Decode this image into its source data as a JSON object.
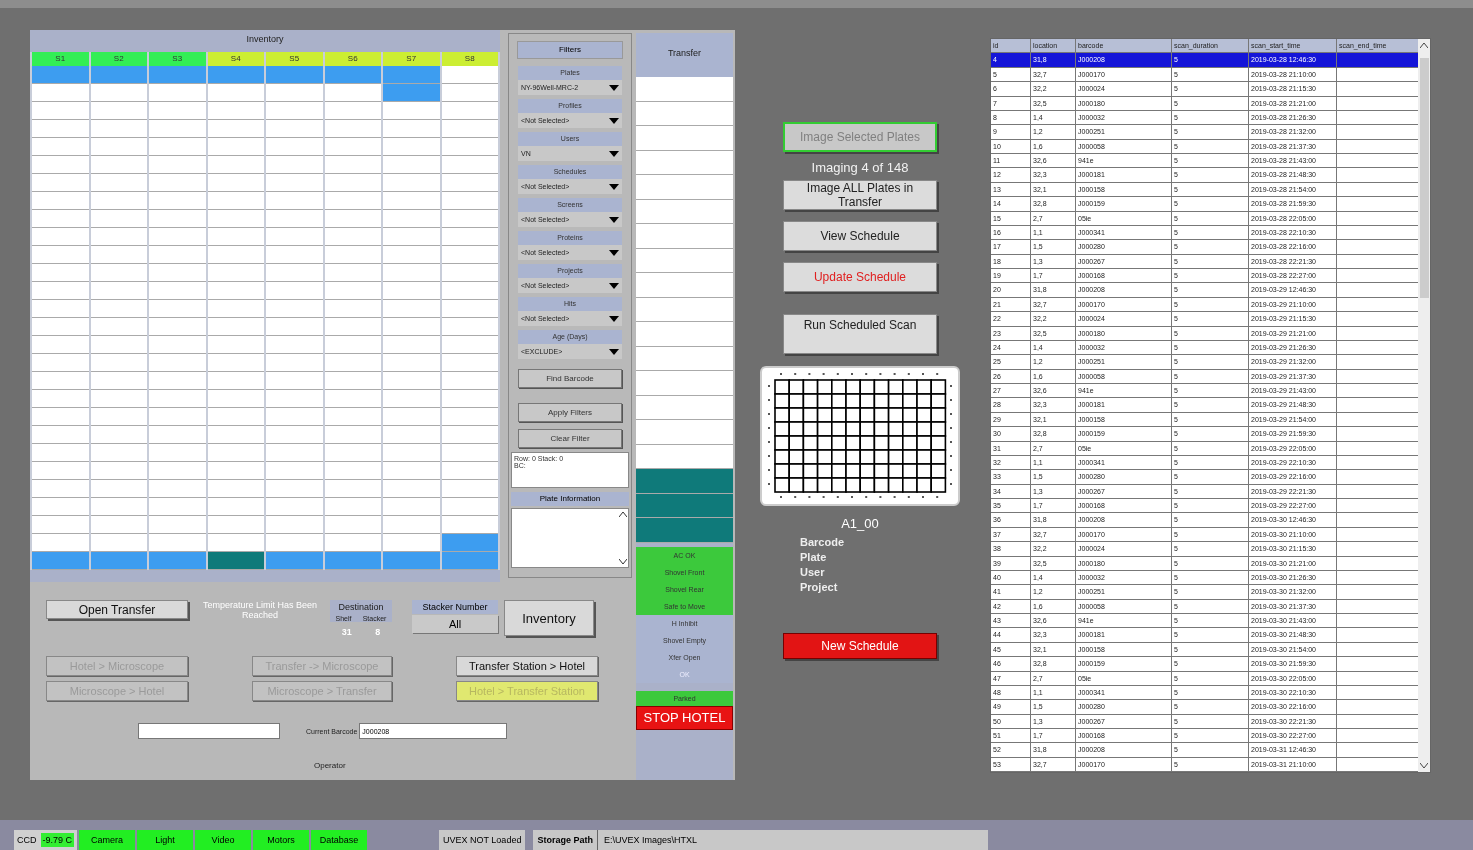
{
  "inventory": {
    "title": "Inventory",
    "columns": [
      {
        "label": "S1",
        "color": "#33ee55",
        "slots": [
          {
            "color": "#3d9df0"
          },
          {
            "color": "#ffffff"
          },
          {
            "color": "#ffffff"
          },
          {
            "color": "#ffffff"
          },
          {
            "color": "#ffffff"
          },
          {
            "color": "#ffffff"
          },
          {
            "color": "#ffffff"
          },
          {
            "color": "#ffffff"
          },
          {
            "color": "#ffffff"
          },
          {
            "color": "#ffffff"
          },
          {
            "color": "#ffffff"
          },
          {
            "color": "#ffffff"
          },
          {
            "color": "#ffffff"
          },
          {
            "color": "#ffffff"
          },
          {
            "color": "#ffffff"
          },
          {
            "color": "#ffffff"
          },
          {
            "color": "#ffffff"
          },
          {
            "color": "#ffffff"
          },
          {
            "color": "#ffffff"
          },
          {
            "color": "#ffffff"
          },
          {
            "color": "#ffffff"
          },
          {
            "color": "#ffffff"
          },
          {
            "color": "#ffffff"
          },
          {
            "color": "#ffffff"
          },
          {
            "color": "#ffffff"
          },
          {
            "color": "#ffffff"
          },
          {
            "color": "#ffffff"
          },
          {
            "color": "#3d9df0"
          }
        ]
      },
      {
        "label": "S2",
        "color": "#33ee55",
        "slots": [
          {
            "color": "#3d9df0"
          },
          {
            "color": "#ffffff"
          },
          {
            "color": "#ffffff"
          },
          {
            "color": "#ffffff"
          },
          {
            "color": "#ffffff"
          },
          {
            "color": "#ffffff"
          },
          {
            "color": "#ffffff"
          },
          {
            "color": "#ffffff"
          },
          {
            "color": "#ffffff"
          },
          {
            "color": "#ffffff"
          },
          {
            "color": "#ffffff"
          },
          {
            "color": "#ffffff"
          },
          {
            "color": "#ffffff"
          },
          {
            "color": "#ffffff"
          },
          {
            "color": "#ffffff"
          },
          {
            "color": "#ffffff"
          },
          {
            "color": "#ffffff"
          },
          {
            "color": "#ffffff"
          },
          {
            "color": "#ffffff"
          },
          {
            "color": "#ffffff"
          },
          {
            "color": "#ffffff"
          },
          {
            "color": "#ffffff"
          },
          {
            "color": "#ffffff"
          },
          {
            "color": "#ffffff"
          },
          {
            "color": "#ffffff"
          },
          {
            "color": "#ffffff"
          },
          {
            "color": "#ffffff"
          },
          {
            "color": "#3d9df0"
          }
        ]
      },
      {
        "label": "S3",
        "color": "#33ee55",
        "slots": [
          {
            "color": "#3d9df0"
          },
          {
            "color": "#ffffff"
          },
          {
            "color": "#ffffff"
          },
          {
            "color": "#ffffff"
          },
          {
            "color": "#ffffff"
          },
          {
            "color": "#ffffff"
          },
          {
            "color": "#ffffff"
          },
          {
            "color": "#ffffff"
          },
          {
            "color": "#ffffff"
          },
          {
            "color": "#ffffff"
          },
          {
            "color": "#ffffff"
          },
          {
            "color": "#ffffff"
          },
          {
            "color": "#ffffff"
          },
          {
            "color": "#ffffff"
          },
          {
            "color": "#ffffff"
          },
          {
            "color": "#ffffff"
          },
          {
            "color": "#ffffff"
          },
          {
            "color": "#ffffff"
          },
          {
            "color": "#ffffff"
          },
          {
            "color": "#ffffff"
          },
          {
            "color": "#ffffff"
          },
          {
            "color": "#ffffff"
          },
          {
            "color": "#ffffff"
          },
          {
            "color": "#ffffff"
          },
          {
            "color": "#ffffff"
          },
          {
            "color": "#ffffff"
          },
          {
            "color": "#ffffff"
          },
          {
            "color": "#3d9df0"
          }
        ]
      },
      {
        "label": "S4",
        "color": "#ccee33",
        "slots": [
          {
            "color": "#3d9df0"
          },
          {
            "color": "#ffffff"
          },
          {
            "color": "#ffffff"
          },
          {
            "color": "#ffffff"
          },
          {
            "color": "#ffffff"
          },
          {
            "color": "#ffffff"
          },
          {
            "color": "#ffffff"
          },
          {
            "color": "#ffffff"
          },
          {
            "color": "#ffffff"
          },
          {
            "color": "#ffffff"
          },
          {
            "color": "#ffffff"
          },
          {
            "color": "#ffffff"
          },
          {
            "color": "#ffffff"
          },
          {
            "color": "#ffffff"
          },
          {
            "color": "#ffffff"
          },
          {
            "color": "#ffffff"
          },
          {
            "color": "#ffffff"
          },
          {
            "color": "#ffffff"
          },
          {
            "color": "#ffffff"
          },
          {
            "color": "#ffffff"
          },
          {
            "color": "#ffffff"
          },
          {
            "color": "#ffffff"
          },
          {
            "color": "#ffffff"
          },
          {
            "color": "#ffffff"
          },
          {
            "color": "#ffffff"
          },
          {
            "color": "#ffffff"
          },
          {
            "color": "#ffffff"
          },
          {
            "color": "#0f7a7a"
          }
        ]
      },
      {
        "label": "S5",
        "color": "#ccee33",
        "slots": [
          {
            "color": "#3d9df0"
          },
          {
            "color": "#ffffff"
          },
          {
            "color": "#ffffff"
          },
          {
            "color": "#ffffff"
          },
          {
            "color": "#ffffff"
          },
          {
            "color": "#ffffff"
          },
          {
            "color": "#ffffff"
          },
          {
            "color": "#ffffff"
          },
          {
            "color": "#ffffff"
          },
          {
            "color": "#ffffff"
          },
          {
            "color": "#ffffff"
          },
          {
            "color": "#ffffff"
          },
          {
            "color": "#ffffff"
          },
          {
            "color": "#ffffff"
          },
          {
            "color": "#ffffff"
          },
          {
            "color": "#ffffff"
          },
          {
            "color": "#ffffff"
          },
          {
            "color": "#ffffff"
          },
          {
            "color": "#ffffff"
          },
          {
            "color": "#ffffff"
          },
          {
            "color": "#ffffff"
          },
          {
            "color": "#ffffff"
          },
          {
            "color": "#ffffff"
          },
          {
            "color": "#ffffff"
          },
          {
            "color": "#ffffff"
          },
          {
            "color": "#ffffff"
          },
          {
            "color": "#ffffff"
          },
          {
            "color": "#3d9df0"
          }
        ]
      },
      {
        "label": "S6",
        "color": "#ccee33",
        "slots": [
          {
            "color": "#3d9df0"
          },
          {
            "color": "#ffffff"
          },
          {
            "color": "#ffffff"
          },
          {
            "color": "#ffffff"
          },
          {
            "color": "#ffffff"
          },
          {
            "color": "#ffffff"
          },
          {
            "color": "#ffffff"
          },
          {
            "color": "#ffffff"
          },
          {
            "color": "#ffffff"
          },
          {
            "color": "#ffffff"
          },
          {
            "color": "#ffffff"
          },
          {
            "color": "#ffffff"
          },
          {
            "color": "#ffffff"
          },
          {
            "color": "#ffffff"
          },
          {
            "color": "#ffffff"
          },
          {
            "color": "#ffffff"
          },
          {
            "color": "#ffffff"
          },
          {
            "color": "#ffffff"
          },
          {
            "color": "#ffffff"
          },
          {
            "color": "#ffffff"
          },
          {
            "color": "#ffffff"
          },
          {
            "color": "#ffffff"
          },
          {
            "color": "#ffffff"
          },
          {
            "color": "#ffffff"
          },
          {
            "color": "#ffffff"
          },
          {
            "color": "#ffffff"
          },
          {
            "color": "#ffffff"
          },
          {
            "color": "#3d9df0"
          }
        ]
      },
      {
        "label": "S7",
        "color": "#ccee33",
        "slots": [
          {
            "color": "#3d9df0"
          },
          {
            "color": "#3d9df0"
          },
          {
            "color": "#ffffff"
          },
          {
            "color": "#ffffff"
          },
          {
            "color": "#ffffff"
          },
          {
            "color": "#ffffff"
          },
          {
            "color": "#ffffff"
          },
          {
            "color": "#ffffff"
          },
          {
            "color": "#ffffff"
          },
          {
            "color": "#ffffff"
          },
          {
            "color": "#ffffff"
          },
          {
            "color": "#ffffff"
          },
          {
            "color": "#ffffff"
          },
          {
            "color": "#ffffff"
          },
          {
            "color": "#ffffff"
          },
          {
            "color": "#ffffff"
          },
          {
            "color": "#ffffff"
          },
          {
            "color": "#ffffff"
          },
          {
            "color": "#ffffff"
          },
          {
            "color": "#ffffff"
          },
          {
            "color": "#ffffff"
          },
          {
            "color": "#ffffff"
          },
          {
            "color": "#ffffff"
          },
          {
            "color": "#ffffff"
          },
          {
            "color": "#ffffff"
          },
          {
            "color": "#ffffff"
          },
          {
            "color": "#ffffff"
          },
          {
            "color": "#3d9df0"
          }
        ]
      },
      {
        "label": "S8",
        "color": "#ccee33",
        "slots": [
          {
            "color": "#ffffff"
          },
          {
            "color": "#ffffff"
          },
          {
            "color": "#ffffff"
          },
          {
            "color": "#ffffff"
          },
          {
            "color": "#ffffff"
          },
          {
            "color": "#ffffff"
          },
          {
            "color": "#ffffff"
          },
          {
            "color": "#ffffff"
          },
          {
            "color": "#ffffff"
          },
          {
            "color": "#ffffff"
          },
          {
            "color": "#ffffff"
          },
          {
            "color": "#ffffff"
          },
          {
            "color": "#ffffff"
          },
          {
            "color": "#ffffff"
          },
          {
            "color": "#ffffff"
          },
          {
            "color": "#ffffff"
          },
          {
            "color": "#ffffff"
          },
          {
            "color": "#ffffff"
          },
          {
            "color": "#ffffff"
          },
          {
            "color": "#ffffff"
          },
          {
            "color": "#ffffff"
          },
          {
            "color": "#ffffff"
          },
          {
            "color": "#ffffff"
          },
          {
            "color": "#ffffff"
          },
          {
            "color": "#ffffff"
          },
          {
            "color": "#ffffff"
          },
          {
            "color": "#3d9df0"
          },
          {
            "color": "#3d9df0"
          }
        ]
      }
    ]
  },
  "filters": {
    "title": "Filters",
    "groups": [
      {
        "label": "Plates",
        "value": "NY-96Well-MRC-2"
      },
      {
        "label": "Profiles",
        "value": "<Not Selected>"
      },
      {
        "label": "Users",
        "value": "VN"
      },
      {
        "label": "Schedules",
        "value": "<Not Selected>"
      },
      {
        "label": "Screens",
        "value": "<Not Selected>"
      },
      {
        "label": "Proteins",
        "value": "<Not Selected>"
      },
      {
        "label": "Projects",
        "value": "<Not Selected>"
      },
      {
        "label": "Hits",
        "value": "<Not Selected>"
      },
      {
        "label": "Age (Days)",
        "value": "<EXCLUDE>"
      }
    ],
    "buttons": [
      "Find Barcode",
      "Apply Filters",
      "Clear Filter"
    ],
    "info_lines": [
      "Row: 0 Stack: 0",
      "BC:"
    ],
    "plate_information_title": "Plate Information"
  },
  "transfer": {
    "title": "Transfer",
    "slots": [
      {
        "color": "#ffffff"
      },
      {
        "color": "#ffffff"
      },
      {
        "color": "#ffffff"
      },
      {
        "color": "#ffffff"
      },
      {
        "color": "#ffffff"
      },
      {
        "color": "#ffffff"
      },
      {
        "color": "#ffffff"
      },
      {
        "color": "#ffffff"
      },
      {
        "color": "#ffffff"
      },
      {
        "color": "#ffffff"
      },
      {
        "color": "#ffffff"
      },
      {
        "color": "#ffffff"
      },
      {
        "color": "#ffffff"
      },
      {
        "color": "#ffffff"
      },
      {
        "color": "#ffffff"
      },
      {
        "color": "#ffffff"
      },
      {
        "color": "#0f7a7a"
      },
      {
        "color": "#0f7a7a"
      },
      {
        "color": "#0f7a7a"
      }
    ],
    "indicators": [
      {
        "label": "AC OK",
        "on": true,
        "disabled": false
      },
      {
        "label": "Shovel Front",
        "on": true,
        "disabled": false
      },
      {
        "label": "Shovel Rear",
        "on": true,
        "disabled": false
      },
      {
        "label": "Safe to Move",
        "on": true,
        "disabled": false
      },
      {
        "label": "H Inhibit",
        "on": false,
        "disabled": false
      },
      {
        "label": "Shovel Empty",
        "on": false,
        "disabled": false
      },
      {
        "label": "Xfer Open",
        "on": false,
        "disabled": false
      },
      {
        "label": "OK",
        "on": false,
        "disabled": true
      },
      {
        "label": "Parked",
        "on": true,
        "disabled": false
      }
    ],
    "stop_button": "STOP HOTEL"
  },
  "controls": {
    "open_transfer": "Open Transfer",
    "temperature_warning": "Temperature Limit Has Been Reached",
    "destination": {
      "title": "Destination",
      "shelf_label": "Shelf",
      "stacker_label": "Stacker",
      "shelf": "31",
      "stacker": "8"
    },
    "stacker_number": {
      "title": "Stacker Number",
      "value": "All"
    },
    "inventory_button": "Inventory",
    "move_buttons": [
      {
        "label": "Hotel > Microscope",
        "kind": "normal",
        "disabled": true
      },
      {
        "label": "Transfer -> Microscope",
        "kind": "normal",
        "disabled": true
      },
      {
        "label": "Transfer Station > Hotel",
        "kind": "normal",
        "disabled": false
      },
      {
        "label": "Microscope > Hotel",
        "kind": "normal",
        "disabled": true
      },
      {
        "label": "Microscope > Transfer",
        "kind": "normal",
        "disabled": true
      },
      {
        "label": "Hotel > Transfer Station",
        "kind": "highlight",
        "disabled": true
      }
    ],
    "current_barcode_label": "Current Barcode",
    "current_barcode": "J000208",
    "operator_label": "Operator"
  },
  "imaging": {
    "status": "Imaging 4 of 148",
    "buttons": [
      {
        "label": "Image Selected Plates",
        "kind": "outlined",
        "disabled": true
      },
      {
        "label": "Image ALL Plates in Transfer",
        "kind": "normal",
        "disabled": false
      },
      {
        "label": "View Schedule",
        "kind": "normal",
        "disabled": false
      },
      {
        "label": "Update Schedule",
        "kind": "alert",
        "disabled": false
      },
      {
        "label": "Run Scheduled Scan",
        "kind": "tall",
        "disabled": false
      }
    ],
    "well": "A1_00",
    "fields": [
      "Barcode",
      "Plate",
      "User",
      "Project"
    ],
    "new_schedule": "New Schedule"
  },
  "schedule_table": {
    "columns": [
      "id",
      "location",
      "barcode",
      "scan_duration",
      "scan_start_time",
      "scan_end_time"
    ],
    "rows": [
      {
        "id": "4",
        "location": "31,8",
        "barcode": "J000208",
        "scan_duration": "5",
        "scan_start_time": "2019-03-28 12:46:30",
        "selected": true
      },
      {
        "id": "5",
        "location": "32,7",
        "barcode": "J000170",
        "scan_duration": "5",
        "scan_start_time": "2019-03-28 21:10:00",
        "selected": false
      },
      {
        "id": "6",
        "location": "32,2",
        "barcode": "J000024",
        "scan_duration": "5",
        "scan_start_time": "2019-03-28 21:15:30",
        "selected": false
      },
      {
        "id": "7",
        "location": "32,5",
        "barcode": "J000180",
        "scan_duration": "5",
        "scan_start_time": "2019-03-28 21:21:00",
        "selected": false
      },
      {
        "id": "8",
        "location": "1,4",
        "barcode": "J000032",
        "scan_duration": "5",
        "scan_start_time": "2019-03-28 21:26:30",
        "selected": false
      },
      {
        "id": "9",
        "location": "1,2",
        "barcode": "J000251",
        "scan_duration": "5",
        "scan_start_time": "2019-03-28 21:32:00",
        "selected": false
      },
      {
        "id": "10",
        "location": "1,6",
        "barcode": "J000058",
        "scan_duration": "5",
        "scan_start_time": "2019-03-28 21:37:30",
        "selected": false
      },
      {
        "id": "11",
        "location": "32,6",
        "barcode": "941e",
        "scan_duration": "5",
        "scan_start_time": "2019-03-28 21:43:00",
        "selected": false
      },
      {
        "id": "12",
        "location": "32,3",
        "barcode": "J000181",
        "scan_duration": "5",
        "scan_start_time": "2019-03-28 21:48:30",
        "selected": false
      },
      {
        "id": "13",
        "location": "32,1",
        "barcode": "J000158",
        "scan_duration": "5",
        "scan_start_time": "2019-03-28 21:54:00",
        "selected": false
      },
      {
        "id": "14",
        "location": "32,8",
        "barcode": "J000159",
        "scan_duration": "5",
        "scan_start_time": "2019-03-28 21:59:30",
        "selected": false
      },
      {
        "id": "15",
        "location": "2,7",
        "barcode": "05ie",
        "scan_duration": "5",
        "scan_start_time": "2019-03-28 22:05:00",
        "selected": false
      },
      {
        "id": "16",
        "location": "1,1",
        "barcode": "J000341",
        "scan_duration": "5",
        "scan_start_time": "2019-03-28 22:10:30",
        "selected": false
      },
      {
        "id": "17",
        "location": "1,5",
        "barcode": "J000280",
        "scan_duration": "5",
        "scan_start_time": "2019-03-28 22:16:00",
        "selected": false
      },
      {
        "id": "18",
        "location": "1,3",
        "barcode": "J000267",
        "scan_duration": "5",
        "scan_start_time": "2019-03-28 22:21:30",
        "selected": false
      },
      {
        "id": "19",
        "location": "1,7",
        "barcode": "J000168",
        "scan_duration": "5",
        "scan_start_time": "2019-03-28 22:27:00",
        "selected": false
      },
      {
        "id": "20",
        "location": "31,8",
        "barcode": "J000208",
        "scan_duration": "5",
        "scan_start_time": "2019-03-29 12:46:30",
        "selected": false
      },
      {
        "id": "21",
        "location": "32,7",
        "barcode": "J000170",
        "scan_duration": "5",
        "scan_start_time": "2019-03-29 21:10:00",
        "selected": false
      },
      {
        "id": "22",
        "location": "32,2",
        "barcode": "J000024",
        "scan_duration": "5",
        "scan_start_time": "2019-03-29 21:15:30",
        "selected": false
      },
      {
        "id": "23",
        "location": "32,5",
        "barcode": "J000180",
        "scan_duration": "5",
        "scan_start_time": "2019-03-29 21:21:00",
        "selected": false
      },
      {
        "id": "24",
        "location": "1,4",
        "barcode": "J000032",
        "scan_duration": "5",
        "scan_start_time": "2019-03-29 21:26:30",
        "selected": false
      },
      {
        "id": "25",
        "location": "1,2",
        "barcode": "J000251",
        "scan_duration": "5",
        "scan_start_time": "2019-03-29 21:32:00",
        "selected": false
      },
      {
        "id": "26",
        "location": "1,6",
        "barcode": "J000058",
        "scan_duration": "5",
        "scan_start_time": "2019-03-29 21:37:30",
        "selected": false
      },
      {
        "id": "27",
        "location": "32,6",
        "barcode": "941e",
        "scan_duration": "5",
        "scan_start_time": "2019-03-29 21:43:00",
        "selected": false
      },
      {
        "id": "28",
        "location": "32,3",
        "barcode": "J000181",
        "scan_duration": "5",
        "scan_start_time": "2019-03-29 21:48:30",
        "selected": false
      },
      {
        "id": "29",
        "location": "32,1",
        "barcode": "J000158",
        "scan_duration": "5",
        "scan_start_time": "2019-03-29 21:54:00",
        "selected": false
      },
      {
        "id": "30",
        "location": "32,8",
        "barcode": "J000159",
        "scan_duration": "5",
        "scan_start_time": "2019-03-29 21:59:30",
        "selected": false
      },
      {
        "id": "31",
        "location": "2,7",
        "barcode": "05ie",
        "scan_duration": "5",
        "scan_start_time": "2019-03-29 22:05:00",
        "selected": false
      },
      {
        "id": "32",
        "location": "1,1",
        "barcode": "J000341",
        "scan_duration": "5",
        "scan_start_time": "2019-03-29 22:10:30",
        "selected": false
      },
      {
        "id": "33",
        "location": "1,5",
        "barcode": "J000280",
        "scan_duration": "5",
        "scan_start_time": "2019-03-29 22:16:00",
        "selected": false
      },
      {
        "id": "34",
        "location": "1,3",
        "barcode": "J000267",
        "scan_duration": "5",
        "scan_start_time": "2019-03-29 22:21:30",
        "selected": false
      },
      {
        "id": "35",
        "location": "1,7",
        "barcode": "J000168",
        "scan_duration": "5",
        "scan_start_time": "2019-03-29 22:27:00",
        "selected": false
      },
      {
        "id": "36",
        "location": "31,8",
        "barcode": "J000208",
        "scan_duration": "5",
        "scan_start_time": "2019-03-30 12:46:30",
        "selected": false
      },
      {
        "id": "37",
        "location": "32,7",
        "barcode": "J000170",
        "scan_duration": "5",
        "scan_start_time": "2019-03-30 21:10:00",
        "selected": false
      },
      {
        "id": "38",
        "location": "32,2",
        "barcode": "J000024",
        "scan_duration": "5",
        "scan_start_time": "2019-03-30 21:15:30",
        "selected": false
      },
      {
        "id": "39",
        "location": "32,5",
        "barcode": "J000180",
        "scan_duration": "5",
        "scan_start_time": "2019-03-30 21:21:00",
        "selected": false
      },
      {
        "id": "40",
        "location": "1,4",
        "barcode": "J000032",
        "scan_duration": "5",
        "scan_start_time": "2019-03-30 21:26:30",
        "selected": false
      },
      {
        "id": "41",
        "location": "1,2",
        "barcode": "J000251",
        "scan_duration": "5",
        "scan_start_time": "2019-03-30 21:32:00",
        "selected": false
      },
      {
        "id": "42",
        "location": "1,6",
        "barcode": "J000058",
        "scan_duration": "5",
        "scan_start_time": "2019-03-30 21:37:30",
        "selected": false
      },
      {
        "id": "43",
        "location": "32,6",
        "barcode": "941e",
        "scan_duration": "5",
        "scan_start_time": "2019-03-30 21:43:00",
        "selected": false
      },
      {
        "id": "44",
        "location": "32,3",
        "barcode": "J000181",
        "scan_duration": "5",
        "scan_start_time": "2019-03-30 21:48:30",
        "selected": false
      },
      {
        "id": "45",
        "location": "32,1",
        "barcode": "J000158",
        "scan_duration": "5",
        "scan_start_time": "2019-03-30 21:54:00",
        "selected": false
      },
      {
        "id": "46",
        "location": "32,8",
        "barcode": "J000159",
        "scan_duration": "5",
        "scan_start_time": "2019-03-30 21:59:30",
        "selected": false
      },
      {
        "id": "47",
        "location": "2,7",
        "barcode": "05ie",
        "scan_duration": "5",
        "scan_start_time": "2019-03-30 22:05:00",
        "selected": false
      },
      {
        "id": "48",
        "location": "1,1",
        "barcode": "J000341",
        "scan_duration": "5",
        "scan_start_time": "2019-03-30 22:10:30",
        "selected": false
      },
      {
        "id": "49",
        "location": "1,5",
        "barcode": "J000280",
        "scan_duration": "5",
        "scan_start_time": "2019-03-30 22:16:00",
        "selected": false
      },
      {
        "id": "50",
        "location": "1,3",
        "barcode": "J000267",
        "scan_duration": "5",
        "scan_start_time": "2019-03-30 22:21:30",
        "selected": false
      },
      {
        "id": "51",
        "location": "1,7",
        "barcode": "J000168",
        "scan_duration": "5",
        "scan_start_time": "2019-03-30 22:27:00",
        "selected": false
      },
      {
        "id": "52",
        "location": "31,8",
        "barcode": "J000208",
        "scan_duration": "5",
        "scan_start_time": "2019-03-31 12:46:30",
        "selected": false
      },
      {
        "id": "53",
        "location": "32,7",
        "barcode": "J000170",
        "scan_duration": "5",
        "scan_start_time": "2019-03-31 21:10:00",
        "selected": false
      }
    ]
  },
  "status_bar": {
    "ccd_label": "CCD",
    "ccd_value": "-9.79 C",
    "indicators": [
      {
        "label": "Camera",
        "on": true
      },
      {
        "label": "Light",
        "on": true
      },
      {
        "label": "Video",
        "on": true
      },
      {
        "label": "Motors",
        "on": true
      },
      {
        "label": "Database",
        "on": true
      }
    ],
    "uvex": "UVEX NOT Loaded",
    "storage_label": "Storage Path",
    "storage_path": "E:\\UVEX Images\\HTXL"
  }
}
